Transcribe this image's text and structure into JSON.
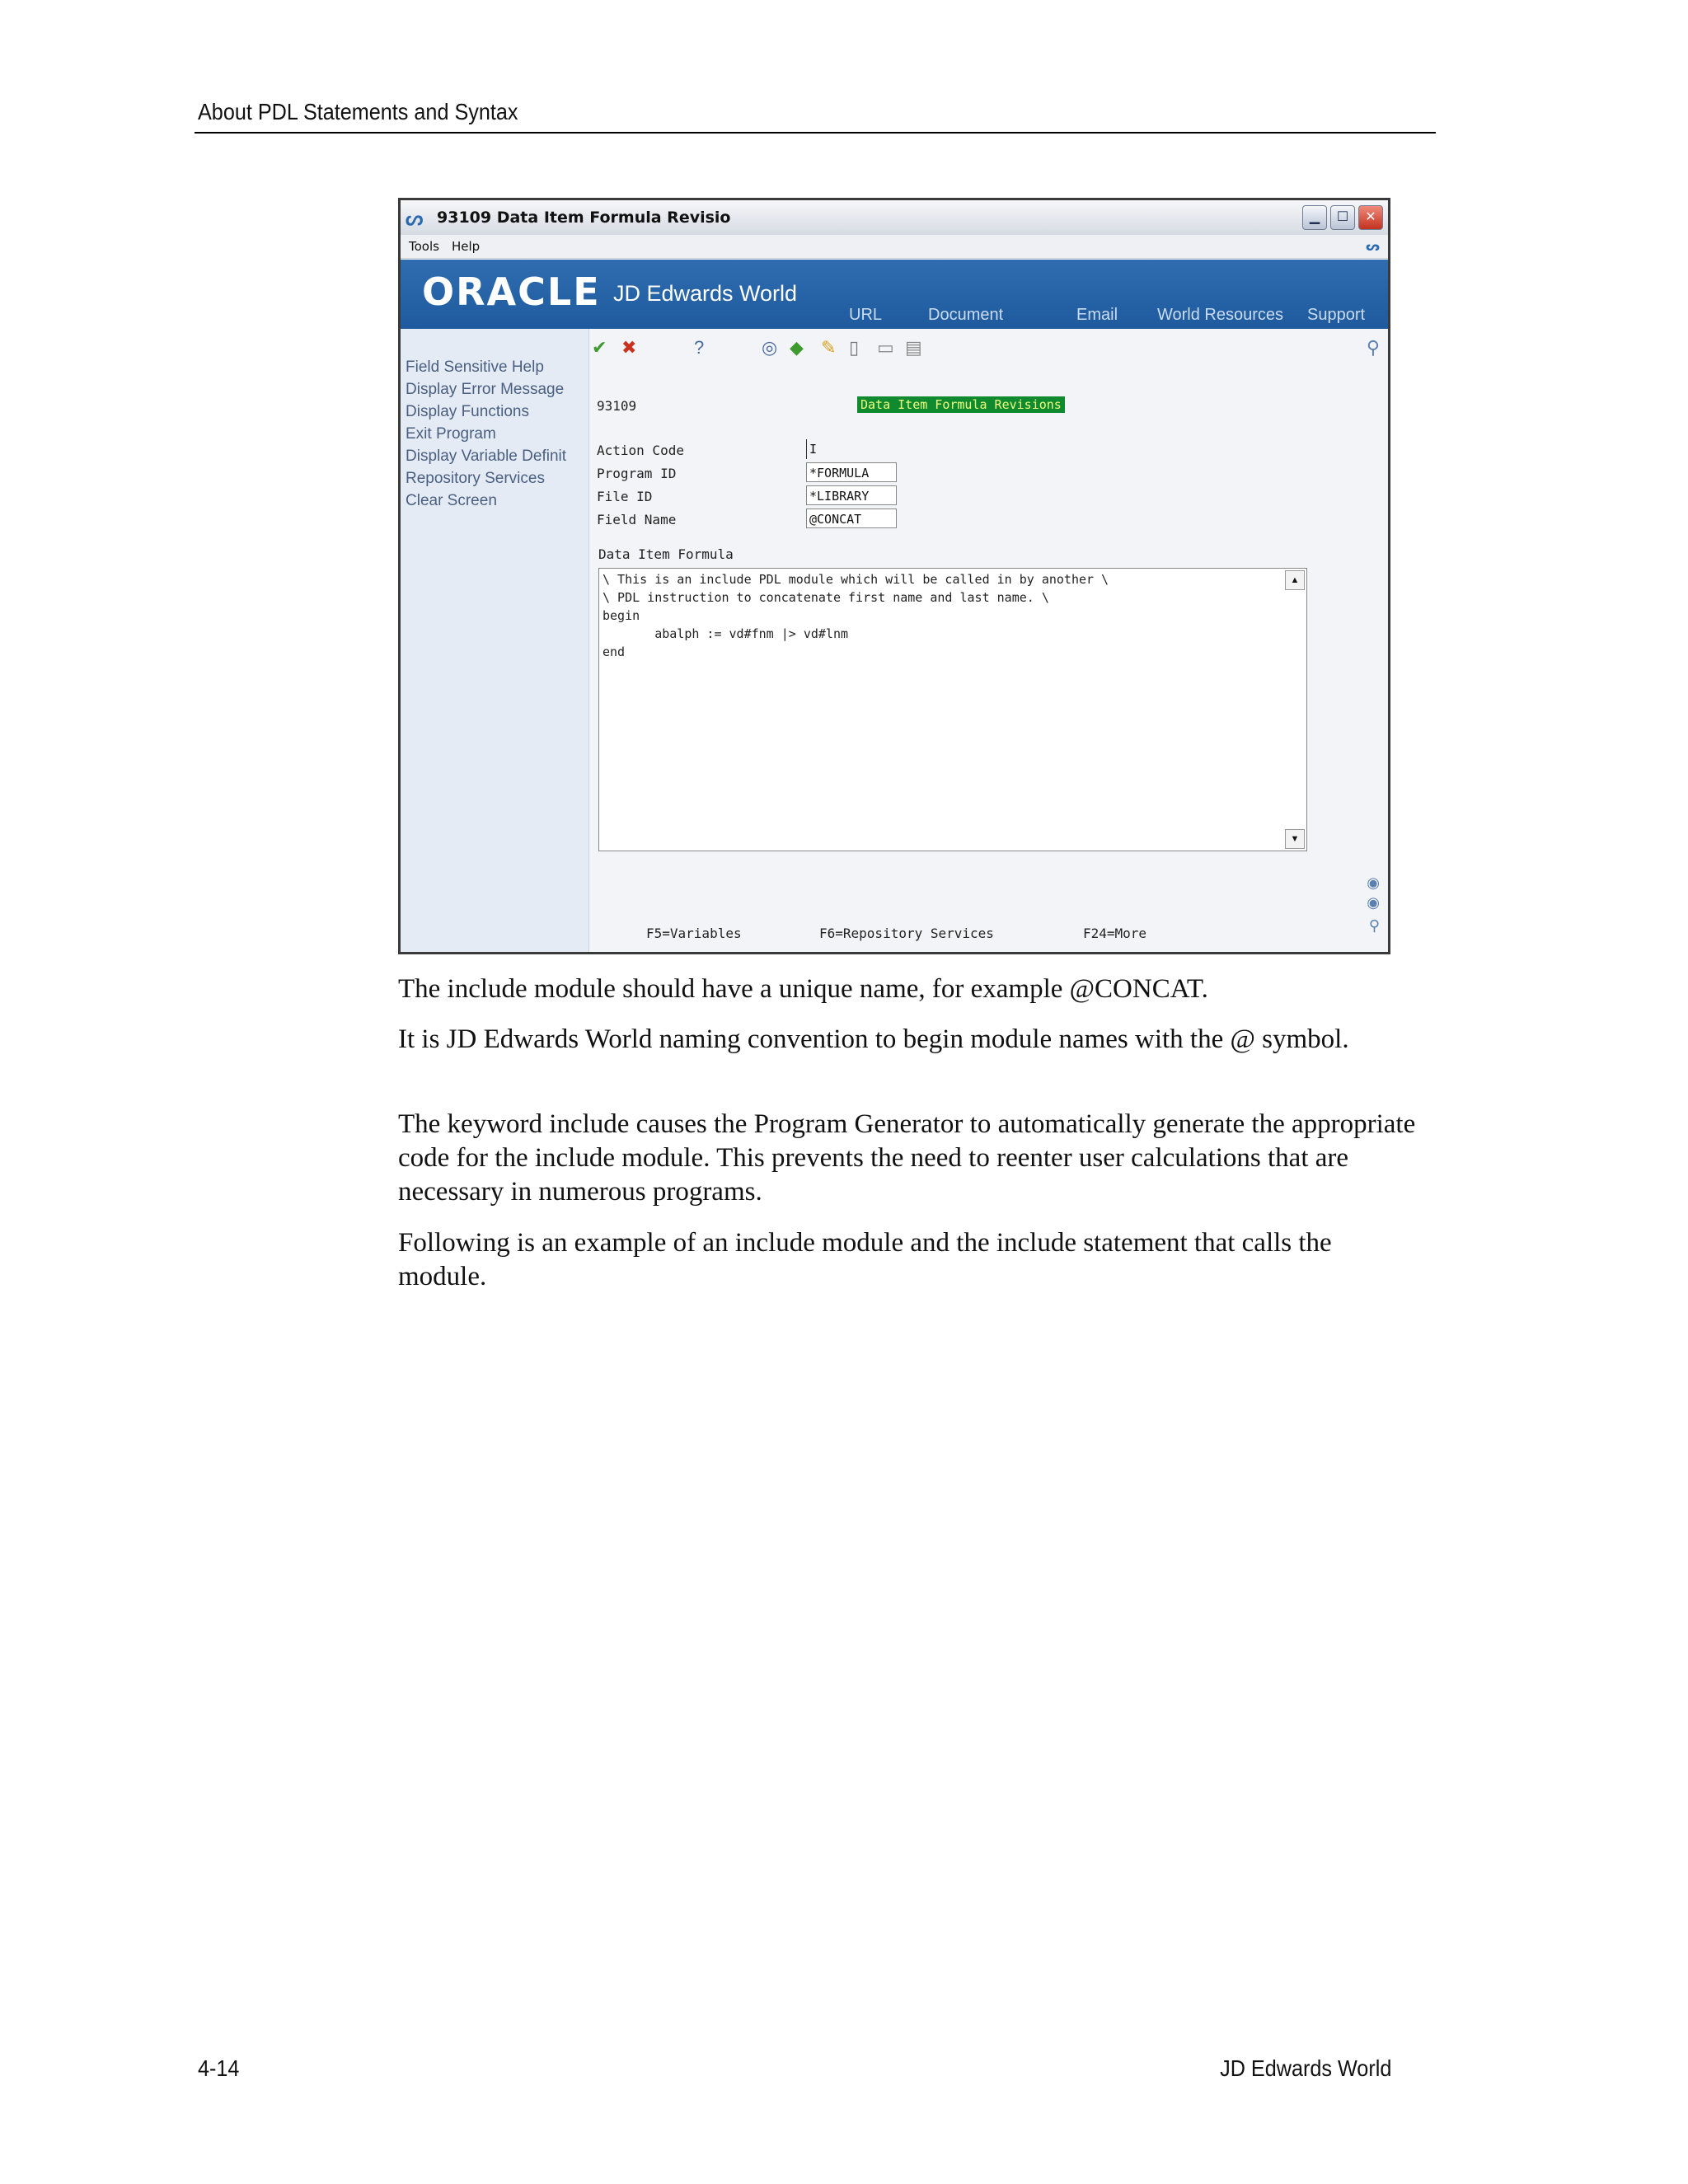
{
  "header": {
    "running_head": "About PDL Statements and Syntax"
  },
  "screenshot": {
    "window_title": "93109    Data Item Formula Revisio",
    "menu": [
      "Tools",
      "Help"
    ],
    "banner": {
      "logo": "ORACLE",
      "product": "JD Edwards World",
      "nav": [
        "URL",
        "Document",
        "Email",
        "World Resources",
        "Support"
      ]
    },
    "sidebar": [
      "Field Sensitive Help",
      "Display Error Message",
      "Display Functions",
      "Exit Program",
      "Display Variable Definit",
      "Repository Services",
      "Clear Screen"
    ],
    "program_number": "93109",
    "screen_title": "Data Item Formula Revisions",
    "fields": [
      {
        "label": "Action Code",
        "value": "I"
      },
      {
        "label": "Program ID",
        "value": "*FORMULA"
      },
      {
        "label": "File ID",
        "value": "*LIBRARY"
      },
      {
        "label": "Field Name",
        "value": "@CONCAT"
      }
    ],
    "formula_label": "Data Item Formula",
    "formula_lines": [
      "\\ This is an include PDL module which will be called in by another \\",
      "\\ PDL instruction to concatenate first name and last name. \\",
      "begin",
      "       abalph := vd#fnm |> vd#lnm",
      "end"
    ],
    "function_keys": [
      "F5=Variables",
      "F6=Repository Services",
      "F24=More"
    ]
  },
  "body": {
    "p1": "The include module should have a unique name, for example @CONCAT.",
    "p2": "It is JD Edwards World naming convention to begin module names with the @ symbol.",
    "p3": "The keyword include causes the Program Generator to automatically generate the appropriate code for the include module. This prevents the need to reenter user calculations that are necessary in numerous programs.",
    "p4": "Following is an example of an include module and the include statement that calls the module."
  },
  "footer": {
    "page_number": "4-14",
    "product": "JD Edwards World"
  }
}
